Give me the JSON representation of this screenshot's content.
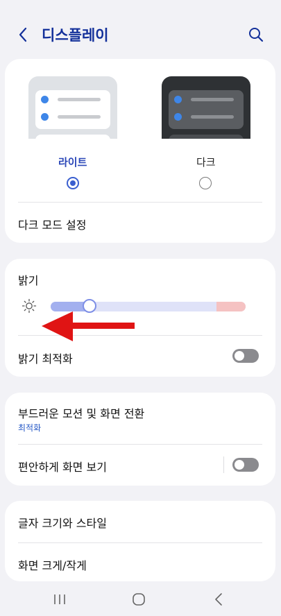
{
  "header": {
    "title": "디스플레이",
    "back_icon": "back-chevron-icon",
    "search_icon": "search-icon",
    "title_color": "#13309a"
  },
  "theme": {
    "light_label": "라이트",
    "dark_label": "다크",
    "selected": "light",
    "accent": "#3a5fcf",
    "dark_mode_settings_label": "다크 모드 설정"
  },
  "brightness": {
    "label": "밝기",
    "level_fraction": 0.2,
    "adaptive_label": "밝기 최적화",
    "adaptive_on": false
  },
  "motion": {
    "label": "부드러운 모션 및 화면 전환",
    "value": "최적화",
    "eye_comfort_label": "편안하게 화면 보기",
    "eye_comfort_on": false
  },
  "text": {
    "font_label": "글자 크기와 스타일",
    "zoom_label": "화면 크게/작게"
  },
  "navbar": {
    "recents_icon": "recents-icon",
    "home_icon": "home-icon",
    "back_icon": "back-icon"
  }
}
